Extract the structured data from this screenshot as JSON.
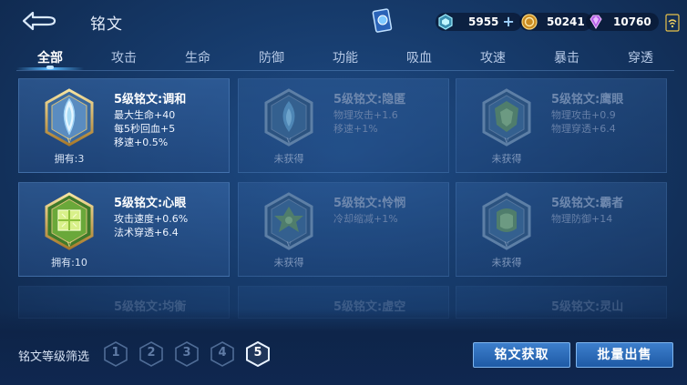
{
  "header": {
    "title": "铭文",
    "currency": [
      {
        "name": "diamond",
        "value": "5955",
        "color": "#6fd3f0"
      },
      {
        "name": "gold",
        "value": "50241",
        "color": "#e6b04a"
      },
      {
        "name": "gem",
        "value": "10760",
        "color": "#c37cf0"
      }
    ]
  },
  "tabs": [
    "全部",
    "攻击",
    "生命",
    "防御",
    "功能",
    "吸血",
    "攻速",
    "暴击",
    "穿透"
  ],
  "active_tab": 0,
  "cards": [
    {
      "name": "5级铭文:调和",
      "attrs": [
        "最大生命+40",
        "每5秒回血+5",
        "移速+0.5%"
      ],
      "owned": "拥有:3",
      "locked": false,
      "color": "#cfe8f4"
    },
    {
      "name": "5级铭文:隐匿",
      "attrs": [
        "物理攻击+1.6",
        "移速+1%"
      ],
      "owned": "未获得",
      "locked": true,
      "color": "#5b8fb5"
    },
    {
      "name": "5级铭文:鹰眼",
      "attrs": [
        "物理攻击+0.9",
        "物理穿透+6.4"
      ],
      "owned": "未获得",
      "locked": true,
      "color": "#5e8a78"
    },
    {
      "name": "5级铭文:心眼",
      "attrs": [
        "攻击速度+0.6%",
        "法术穿透+6.4"
      ],
      "owned": "拥有:10",
      "locked": false,
      "color": "#9fd44a"
    },
    {
      "name": "5级铭文:怜悯",
      "attrs": [
        "冷却缩减+1%"
      ],
      "owned": "未获得",
      "locked": true,
      "color": "#5e8a78"
    },
    {
      "name": "5级铭文:霸者",
      "attrs": [
        "物理防御+14"
      ],
      "owned": "未获得",
      "locked": true,
      "color": "#5e8a78"
    },
    {
      "name": "5级铭文:均衡",
      "attrs": [],
      "owned": "",
      "locked": true,
      "color": "#5b8fb5"
    },
    {
      "name": "5级铭文:虚空",
      "attrs": [],
      "owned": "",
      "locked": true,
      "color": "#5b8fb5"
    },
    {
      "name": "5级铭文:灵山",
      "attrs": [],
      "owned": "",
      "locked": true,
      "color": "#5e8a78"
    }
  ],
  "filter": {
    "label": "铭文等级筛选",
    "levels": [
      "1",
      "2",
      "3",
      "4",
      "5"
    ],
    "active": 4
  },
  "buttons": {
    "obtain": "铭文获取",
    "sell": "批量出售"
  }
}
